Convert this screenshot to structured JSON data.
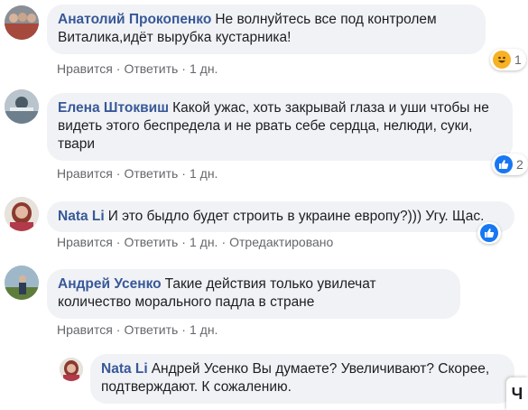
{
  "comments": [
    {
      "author": "Анатолий Прокопенко",
      "text": "Не волнуйтесь все под контролем Виталика,идёт вырубка кустарника!",
      "like": "Нравится",
      "reply": "Ответить",
      "time": "1 дн.",
      "reaction_count": "1",
      "reaction_icon": "haha-icon"
    },
    {
      "author": "Елена Штоквиш",
      "text": "Какой ужас, хоть закрывай глаза и уши чтобы не видеть этого беспредела и не рвать себе сердца, нелюди, суки, твари",
      "like": "Нравится",
      "reply": "Ответить",
      "time": "1 дн.",
      "reaction_count": "2",
      "reaction_icon": "like-icon"
    },
    {
      "author": "Nata Li",
      "text": "И это быдло будет строить в украине европу?))) Угу. Щас.",
      "like": "Нравится",
      "reply": "Ответить",
      "time": "1 дн.",
      "edited": "Отредактировано",
      "reaction_icon": "like-icon"
    },
    {
      "author": "Андрей Усенко",
      "text": "Такие действия только увилечат количество морального падла в стране",
      "like": "Нравится",
      "reply": "Ответить",
      "time": "1 дн."
    }
  ],
  "reply": {
    "author": "Nata Li",
    "text": "Андрей Усенко Вы думаете? Увеличивают? Скорее, подтверждают. К сожалению."
  },
  "corner_label": "Ч",
  "colors": {
    "author": "#385898",
    "bubble": "#f0f2f5",
    "meta": "#65676b",
    "like": "#1877f2"
  }
}
